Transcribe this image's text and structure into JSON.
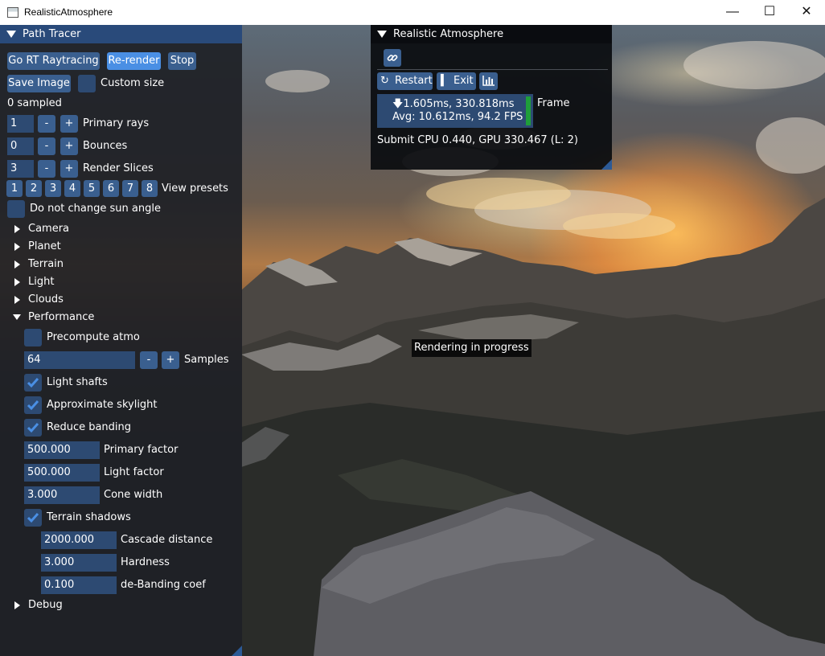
{
  "window": {
    "title": "RealisticAtmosphere"
  },
  "colors": {
    "accent": "#4a8fe4",
    "button": "#3a5f8f",
    "frame": "#2d4a72",
    "header": "#294a7a",
    "fps_bar": "#1f9e3a"
  },
  "path_tracer": {
    "title": "Path Tracer",
    "buttons": {
      "go_rt": "Go RT Raytracing",
      "rerender": "Re-render",
      "stop": "Stop",
      "save_image": "Save Image"
    },
    "custom_size_label": "Custom size",
    "sampled_text": "0 sampled",
    "steppers": [
      {
        "value": "1",
        "label": "Primary rays"
      },
      {
        "value": "0",
        "label": "Bounces"
      },
      {
        "value": "3",
        "label": "Render Slices"
      }
    ],
    "minus": "-",
    "plus": "+",
    "presets": [
      "1",
      "2",
      "3",
      "4",
      "5",
      "6",
      "7",
      "8"
    ],
    "presets_label": "View presets",
    "sun_angle_label": "Do not change sun angle",
    "sections": [
      "Camera",
      "Planet",
      "Terrain",
      "Light",
      "Clouds"
    ],
    "performance": {
      "title": "Performance",
      "precompute_label": "Precompute atmo",
      "samples_value": "64",
      "samples_label": "Samples",
      "light_shafts": "Light shafts",
      "approx_skylight": "Approximate skylight",
      "reduce_banding": "Reduce banding",
      "primary_factor_value": "500.000",
      "primary_factor_label": "Primary factor",
      "light_factor_value": "500.000",
      "light_factor_label": "Light factor",
      "cone_width_value": "3.000",
      "cone_width_label": "Cone width",
      "terrain_shadows": "Terrain shadows",
      "cascade_value": "2000.000",
      "cascade_label": "Cascade distance",
      "hardness_value": "3.000",
      "hardness_label": "Hardness",
      "debanding_value": "0.100",
      "debanding_label": "de-Banding coef"
    },
    "debug_label": "Debug"
  },
  "atmosphere": {
    "title": "Realistic Atmosphere",
    "restart": "Restart",
    "exit": "Exit",
    "frame_line1": "1.605ms, 330.818ms",
    "frame_line2": "Avg: 10.612ms, 94.2 FPS",
    "frame_label": "Frame",
    "submit_text": "Submit CPU 0.440, GPU 330.467 (L: 2)"
  },
  "status_tooltip": "Rendering in progress"
}
